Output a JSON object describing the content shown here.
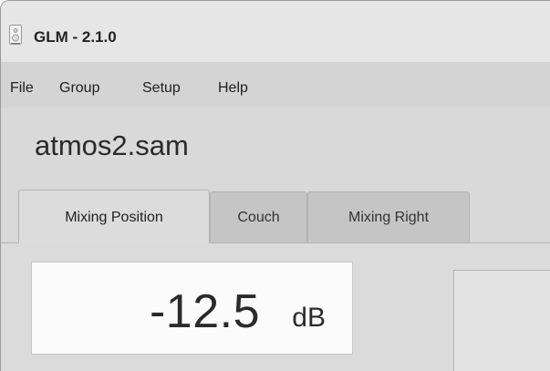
{
  "window": {
    "title": "GLM - 2.1.0",
    "icon": "speaker-icon"
  },
  "menu": {
    "items": [
      "File",
      "Group",
      "Setup",
      "Help"
    ]
  },
  "setup_file": "atmos2.sam",
  "tabs": [
    {
      "label": "Mixing Position",
      "active": true
    },
    {
      "label": "Couch",
      "active": false
    },
    {
      "label": "Mixing Right",
      "active": false
    }
  ],
  "level": {
    "value": "-12.5",
    "unit": "dB"
  }
}
